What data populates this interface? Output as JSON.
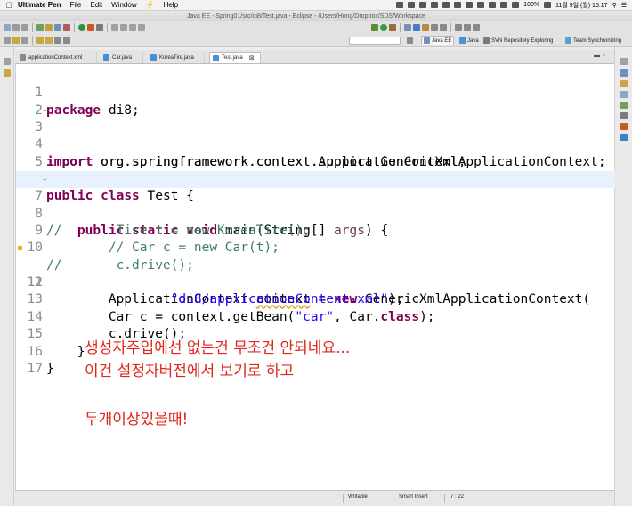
{
  "menubar": {
    "app_name": "Ultimate Pen",
    "items": [
      "File",
      "Edit",
      "Window",
      "Help"
    ],
    "battery": "100%",
    "clock": "11월 9일 (월)  15:17"
  },
  "window": {
    "title": "Java EE - Spring01/src/di8/Test.java - Eclipse - /Users/Hong/Dropbox/SDS/Workspace"
  },
  "perspectives": {
    "java_ee": "Java EE",
    "java": "Java",
    "svn": "SVN Repository Exploring",
    "team": "Team Synchronizing"
  },
  "tabs": [
    {
      "label": "applicationContext.xml",
      "active": false
    },
    {
      "label": "Car.java",
      "active": false
    },
    {
      "label": "KoreaTire.java",
      "active": false
    },
    {
      "label": "Test.java",
      "active": true
    }
  ],
  "code_lines": [
    {
      "n": "1"
    },
    {
      "n": "2"
    },
    {
      "n": "3"
    },
    {
      "n": "4"
    },
    {
      "n": "5"
    },
    {
      "n": "6"
    },
    {
      "n": "7"
    },
    {
      "n": "8"
    },
    {
      "n": "9"
    },
    {
      "n": "10"
    },
    {
      "n": "11"
    },
    {
      "n": "12"
    },
    {
      "n": "13"
    },
    {
      "n": "14"
    },
    {
      "n": "15"
    },
    {
      "n": "16"
    },
    {
      "n": "17"
    }
  ],
  "code": {
    "l1": {
      "kw": "package",
      "rest": " di8;"
    },
    "l3": {
      "kw": "import",
      "rest": " org.springframework.context.ApplicationContext;"
    },
    "l4": {
      "kw": "import",
      "rest": " org.springframework.context.support.GenericXmlApplicationContext;"
    },
    "l6": {
      "kw1": "public",
      "kw2": "class",
      "rest": " Test {"
    },
    "l7": {
      "indent": "    ",
      "kw1": "public",
      "kw2": "static",
      "kw3": "void",
      "a": " main(String[] ",
      "param": "args",
      "b": ") {"
    },
    "l8": {
      "comment": "//       Tire t = new KoreaTire();"
    },
    "l9": {
      "indent": "        ",
      "comment": "// Car c = new Car(t);"
    },
    "l10": {
      "comment": "//       c.drive();"
    },
    "l11": {
      "a": "        ApplicationContext ",
      "var": "context",
      "b": " = ",
      "kw": "new",
      "c": " GenericXmlApplicationContext("
    },
    "l12": {
      "indent": "                ",
      "str": "\"di8/applicationContext.xml\"",
      "b": ");"
    },
    "l13": {
      "a": "        Car c = ",
      "var": "context",
      "b": ".getBean(",
      "str": "\"car\"",
      "c": ", Car.",
      "kw": "class",
      "d": ");"
    },
    "l14": {
      "a": "        c.drive();"
    },
    "l15": {
      "a": "    }"
    },
    "l16": {
      "a": "}"
    }
  },
  "notes": {
    "line1": "생성자주입에선 없는건 무조건 안되네요...",
    "line2": "이건 설정자버전에서 보기로 하고",
    "line3": "두개이상있을때!"
  },
  "status": {
    "writable": "Writable",
    "insert_mode": "Smart Insert",
    "position": "7 : 22"
  },
  "colors": {
    "keyword": "#7f0055",
    "comment": "#3f7f5f",
    "string": "#2a00ff",
    "field": "#0000c0",
    "note": "#e0261b",
    "current_line": "#e8f2fe"
  }
}
